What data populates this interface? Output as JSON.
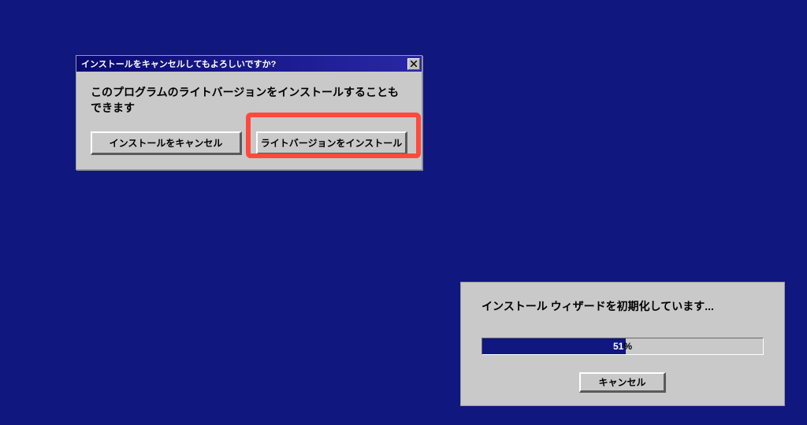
{
  "cancel_dialog": {
    "title": "インストールをキャンセルしてもよろしいですか?",
    "message": "このプログラムのライトバージョンをインストールすることもできます",
    "cancel_button": "インストールをキャンセル",
    "lite_button": "ライトバージョンをインストール"
  },
  "progress_dialog": {
    "title": "インストール ウィザードを初期化しています...",
    "percent": 51,
    "percent_label": "51%",
    "cancel_button": "キャンセル"
  }
}
